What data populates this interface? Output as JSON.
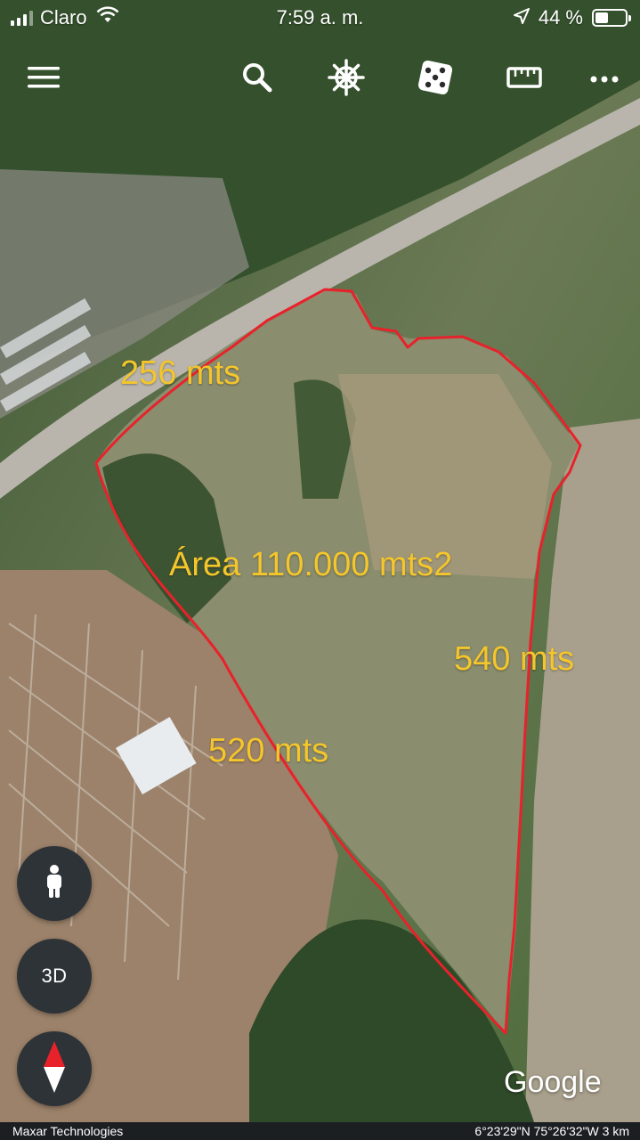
{
  "status_bar": {
    "carrier": "Claro",
    "time": "7:59 a. m.",
    "battery_text": "44 %",
    "battery_level": 0.44
  },
  "toolbar": {
    "icons": [
      "menu-icon",
      "search-icon",
      "ship-wheel-icon",
      "dice-icon",
      "ruler-icon",
      "more-icon"
    ]
  },
  "annotations": {
    "top_side": "256 mts",
    "area": "Área 110.000 mts2",
    "right_side": "540 mts",
    "left_side": "520 mts"
  },
  "controls": {
    "pegman_icon": "person-icon",
    "view_3d_label": "3D",
    "compass_icon": "compass-icon"
  },
  "branding": {
    "logo_text": "Google"
  },
  "footer": {
    "attribution": "Maxar Technologies",
    "coordinates": "6°23'29\"N 75°26'32\"W  3 km"
  },
  "colors": {
    "boundary": "#e8222a",
    "label": "#f4c62c",
    "button_bg": "#2e3338"
  }
}
